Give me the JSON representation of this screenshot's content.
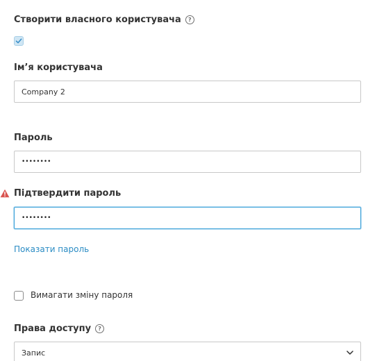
{
  "custom_user": {
    "label": "Створити власного користувача",
    "help_icon": "question-circle-icon",
    "checked": true
  },
  "username": {
    "label": "Ім’я користувача",
    "value": "Company 2"
  },
  "password": {
    "label": "Пароль",
    "value": "••••••••"
  },
  "confirm_password": {
    "label": "Підтвердити пароль",
    "value": "••••••••",
    "warning_icon": "warning-triangle-icon"
  },
  "show_password_link": "Показати пароль",
  "require_change": {
    "label": "Вимагати зміну пароля",
    "checked": false
  },
  "access_rights": {
    "label": "Права доступу",
    "help_icon": "question-circle-icon",
    "selected": "Запис"
  },
  "colors": {
    "link": "#2b8cc4",
    "focus_border": "#3aa0d8",
    "warning": "#d9534f",
    "checkbox_checked": "#cfe6f4"
  }
}
